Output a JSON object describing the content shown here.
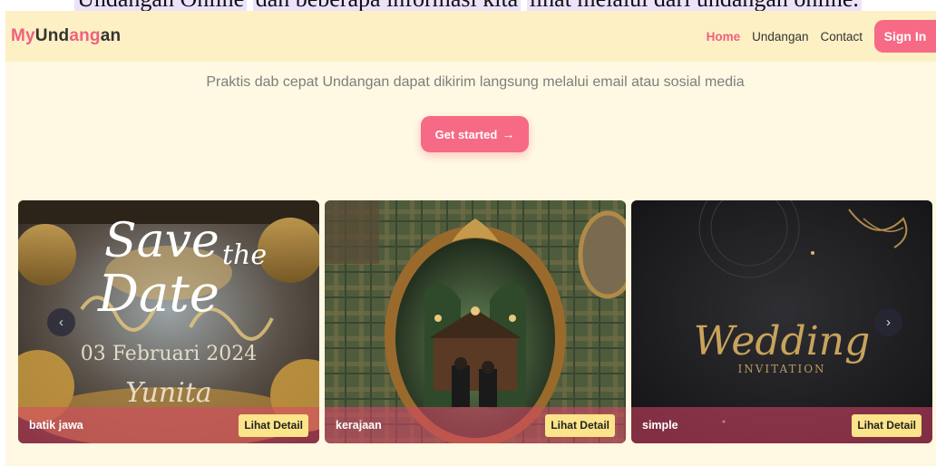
{
  "clipped_heading": {
    "segments": [
      "Undangan Online",
      "dan beberapa informasi kita",
      "lihat melalui dari undangan online."
    ]
  },
  "brand": {
    "part1": "My",
    "part2": "Und",
    "part3": "ang",
    "part4": "an"
  },
  "nav": {
    "items": [
      {
        "label": "Home",
        "active": true
      },
      {
        "label": "Undangan",
        "active": false
      },
      {
        "label": "Contact",
        "active": false
      }
    ],
    "signin_label": "Sign In"
  },
  "hero": {
    "subtitle": "Praktis dab cepat Undangan dapat dikirim langsung melalui email atau sosial media",
    "cta_label": "Get started",
    "cta_icon": "arrow-right-icon"
  },
  "carousel": {
    "prev_icon": "chevron-left-icon",
    "next_icon": "chevron-right-icon",
    "cards": [
      {
        "label": "batik jawa",
        "button": "Lihat Detail",
        "art": {
          "script1": "Save",
          "script2": "the",
          "script3": "Date",
          "date": "03 Februari 2024",
          "name": "Yunita"
        }
      },
      {
        "label": "kerajaan",
        "button": "Lihat Detail"
      },
      {
        "label": "simple",
        "button": "Lihat Detail",
        "art": {
          "title": "Wedding",
          "subtitle": "INVITATION"
        }
      }
    ]
  },
  "colors": {
    "accent": "#f66a86",
    "navbar_bg": "#fdf0c4",
    "page_bg": "#fff9e3",
    "detail_button": "#fbe48a"
  }
}
